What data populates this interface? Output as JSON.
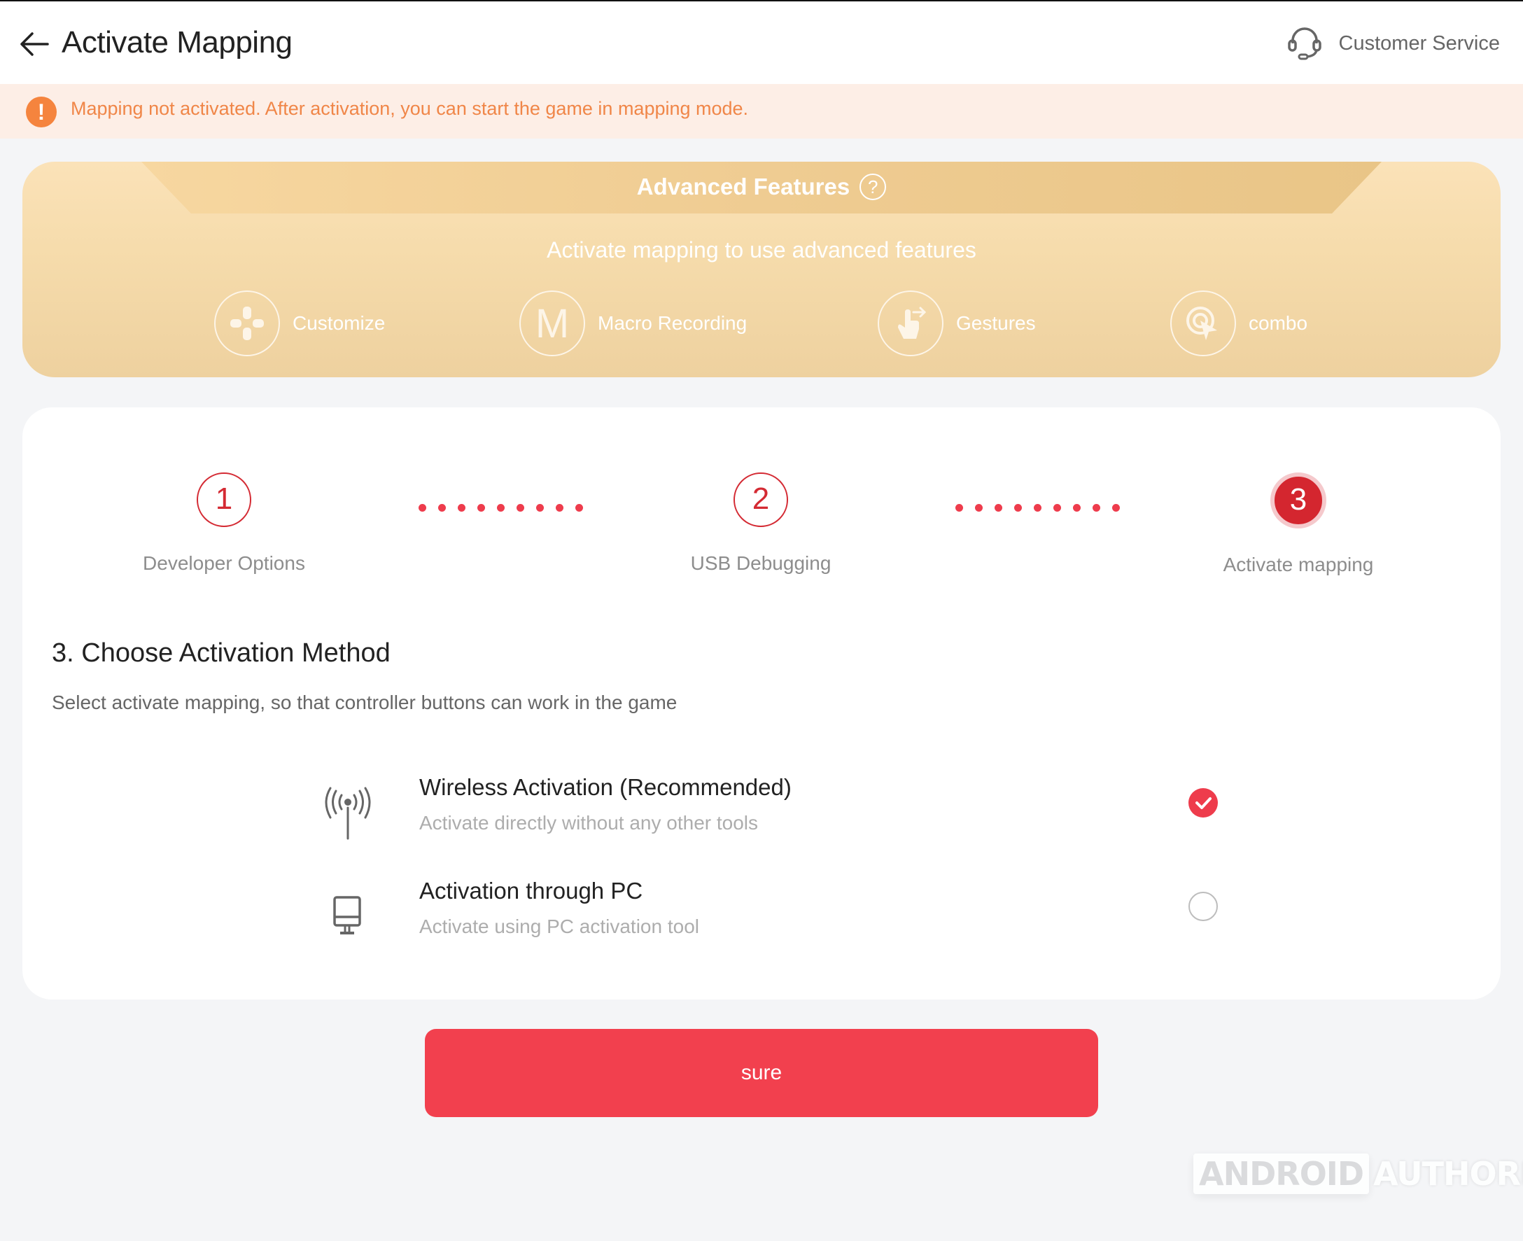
{
  "header": {
    "title": "Activate Mapping",
    "back_icon": "arrow-left-icon",
    "customer_service": {
      "label": "Customer Service",
      "icon": "headset-icon"
    }
  },
  "banner": {
    "icon": "exclamation-icon",
    "text": "Mapping not activated. After activation, you can start the game in mapping mode."
  },
  "advanced_features": {
    "title": "Advanced Features",
    "help_icon": "?",
    "subtitle": "Activate mapping to use advanced features",
    "features": [
      {
        "label": "Customize",
        "icon": "dpad-icon"
      },
      {
        "label": "Macro Recording",
        "icon": "macro-m-icon",
        "glyph": "M"
      },
      {
        "label": "Gestures",
        "icon": "swipe-hand-icon"
      },
      {
        "label": "combo",
        "icon": "target-cursor-icon"
      }
    ]
  },
  "stepper": {
    "current_step": 3,
    "steps": [
      {
        "number": "1",
        "label": "Developer Options",
        "state": "done"
      },
      {
        "number": "2",
        "label": "USB Debugging",
        "state": "done"
      },
      {
        "number": "3",
        "label": "Activate mapping",
        "state": "active"
      }
    ]
  },
  "section": {
    "title": "3. Choose Activation Method",
    "description": "Select activate mapping, so that controller buttons can work in the game"
  },
  "options": [
    {
      "title": "Wireless Activation (Recommended)",
      "subtitle": "Activate directly without any other tools",
      "icon": "wireless-antenna-icon",
      "selected": true
    },
    {
      "title": "Activation through PC",
      "subtitle": "Activate using PC activation tool",
      "icon": "desktop-monitor-icon",
      "selected": false
    }
  ],
  "confirm_button": {
    "label": "sure"
  },
  "watermark": {
    "part1": "ANDROID",
    "part2": "AUTHORITY"
  },
  "colors": {
    "accent_red": "#f2404e",
    "step_red": "#d42a33",
    "warning_orange": "#f5843e",
    "banner_bg": "#fdeee6",
    "gold_card": "#f6dcac"
  }
}
